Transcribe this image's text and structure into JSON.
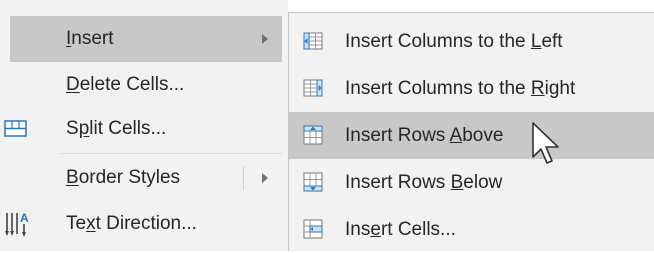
{
  "context_menu": {
    "items": [
      {
        "label_pre": "",
        "label_key": "I",
        "label_post": "nsert",
        "has_submenu": true,
        "highlighted": true,
        "icon": ""
      },
      {
        "label_pre": "",
        "label_key": "D",
        "label_post": "elete Cells...",
        "has_submenu": false,
        "highlighted": false,
        "icon": ""
      },
      {
        "label_pre": "S",
        "label_key": "p",
        "label_post": "lit Cells...",
        "has_submenu": false,
        "highlighted": false,
        "icon": "split-cells-icon"
      },
      {
        "label_pre": "",
        "label_key": "B",
        "label_post": "order Styles",
        "has_submenu": true,
        "highlighted": false,
        "icon": ""
      },
      {
        "label_pre": "Te",
        "label_key": "x",
        "label_post": "t Direction...",
        "has_submenu": false,
        "highlighted": false,
        "icon": "text-direction-icon"
      }
    ]
  },
  "insert_submenu": {
    "items": [
      {
        "label_pre": "Insert Columns to the ",
        "label_key": "L",
        "label_post": "eft",
        "icon": "insert-columns-left-icon",
        "highlighted": false
      },
      {
        "label_pre": "Insert Columns to the ",
        "label_key": "R",
        "label_post": "ight",
        "icon": "insert-columns-right-icon",
        "highlighted": false
      },
      {
        "label_pre": "Insert Rows ",
        "label_key": "A",
        "label_post": "bove",
        "icon": "insert-rows-above-icon",
        "highlighted": true
      },
      {
        "label_pre": "Insert Rows ",
        "label_key": "B",
        "label_post": "elow",
        "icon": "insert-rows-below-icon",
        "highlighted": false
      },
      {
        "label_pre": "Ins",
        "label_key": "e",
        "label_post": "rt Cells...",
        "icon": "insert-cells-icon",
        "highlighted": false
      }
    ]
  },
  "colors": {
    "menu_bg": "#f2f2f2",
    "highlight_bg": "#c8c8c8",
    "text": "#262626",
    "icon_blue": "#2e75b6"
  }
}
